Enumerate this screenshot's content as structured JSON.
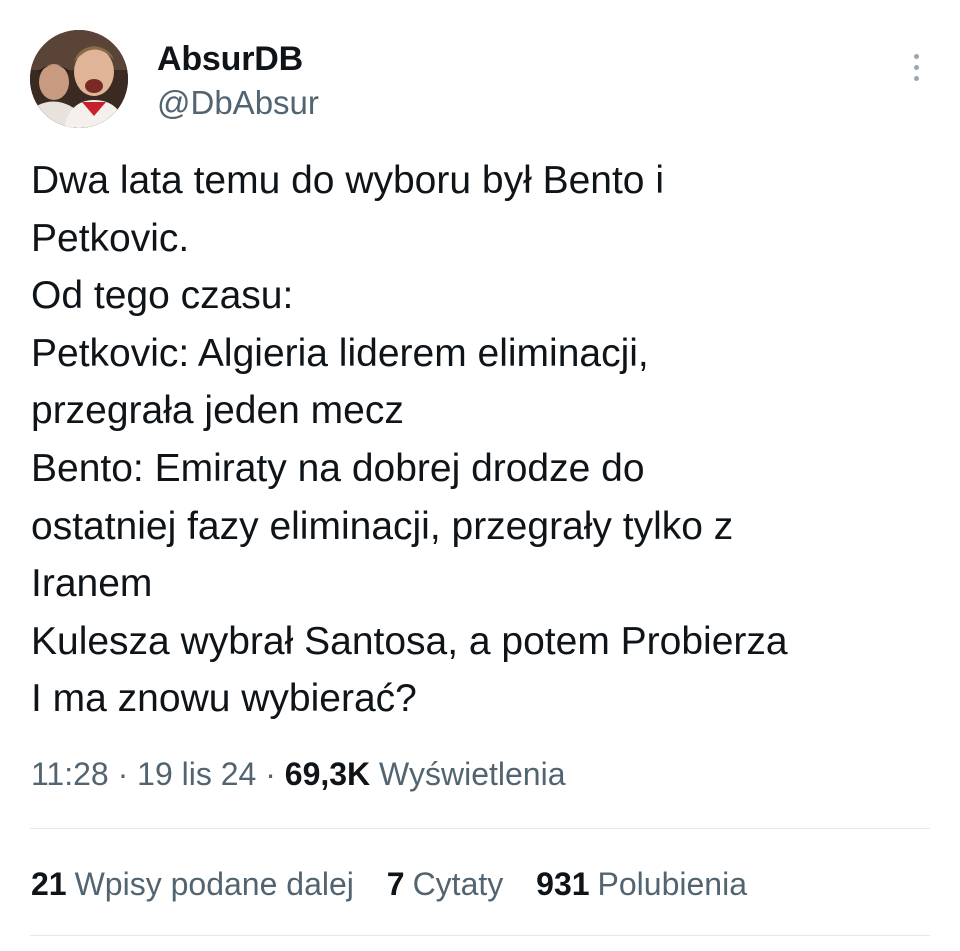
{
  "author": {
    "display_name": "AbsurDB",
    "handle": "@DbAbsur",
    "avatar_icon": "profile-photo-avatar"
  },
  "more_icon": "more-vertical-icon",
  "tweet": {
    "lines": [
      "Dwa lata temu do wyboru był Bento i",
      "Petkovic.",
      "Od tego czasu:",
      "Petkovic: Algieria liderem eliminacji,",
      "przegrała jeden mecz",
      "Bento: Emiraty na dobrej drodze do",
      "ostatniej fazy eliminacji, przegrały tylko z",
      "Iranem",
      "Kulesza wybrał Santosa, a potem Probierza",
      "I ma znowu wybierać?"
    ]
  },
  "meta": {
    "time": "11:28",
    "sep1": " · ",
    "date": "19 lis 24",
    "sep2": " · ",
    "views_count": "69,3K",
    "views_label": "Wyświetlenia"
  },
  "stats": {
    "retweets_count": "21",
    "retweets_label": "Wpisy podane dalej",
    "quotes_count": "7",
    "quotes_label": "Cytaty",
    "likes_count": "931",
    "likes_label": "Polubienia"
  },
  "colors": {
    "text_primary": "#0f1419",
    "text_secondary": "#536471",
    "divider": "#e6e9eb"
  }
}
